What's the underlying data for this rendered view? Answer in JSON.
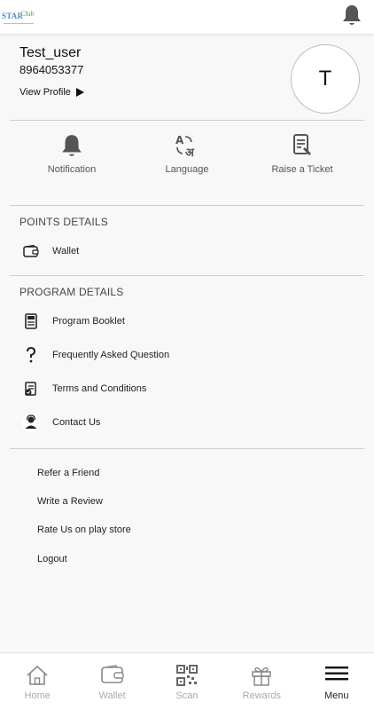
{
  "header": {
    "logo": {
      "text_main": "STAR",
      "text_script": "Club"
    },
    "icon": "bell-icon"
  },
  "profile": {
    "name": "Test_user",
    "phone": "8964053377",
    "view_profile": "View Profile",
    "avatar_initial": "T"
  },
  "quick_actions": [
    {
      "label": "Notification",
      "icon": "bell-icon"
    },
    {
      "label": "Language",
      "icon": "language-icon"
    },
    {
      "label": "Raise a Ticket",
      "icon": "ticket-icon"
    }
  ],
  "points": {
    "title": "POINTS DETAILS",
    "items": [
      {
        "label": "Wallet",
        "icon": "wallet-icon"
      }
    ]
  },
  "program": {
    "title": "PROGRAM DETAILS",
    "items": [
      {
        "label": "Program Booklet",
        "icon": "booklet-icon"
      },
      {
        "label": "Frequently Asked Question",
        "icon": "question-icon"
      },
      {
        "label": "Terms and Conditions",
        "icon": "terms-icon"
      },
      {
        "label": "Contact Us",
        "icon": "contact-icon"
      }
    ]
  },
  "links": [
    {
      "label": "Refer a Friend"
    },
    {
      "label": "Write a Review"
    },
    {
      "label": "Rate Us on play store"
    },
    {
      "label": "Logout"
    }
  ],
  "bottom_nav": [
    {
      "label": "Home",
      "icon": "home-icon"
    },
    {
      "label": "Wallet",
      "icon": "wallet-icon"
    },
    {
      "label": "Scan",
      "icon": "qr-icon"
    },
    {
      "label": "Rewards",
      "icon": "gift-icon"
    },
    {
      "label": "Menu",
      "icon": "menu-icon",
      "active": true
    }
  ],
  "colors": {
    "background": "#f8f8f8",
    "surface": "#ffffff",
    "divider": "#cfcfcf",
    "icon": "#555555",
    "nav_inactive": "#aaaaaa"
  }
}
